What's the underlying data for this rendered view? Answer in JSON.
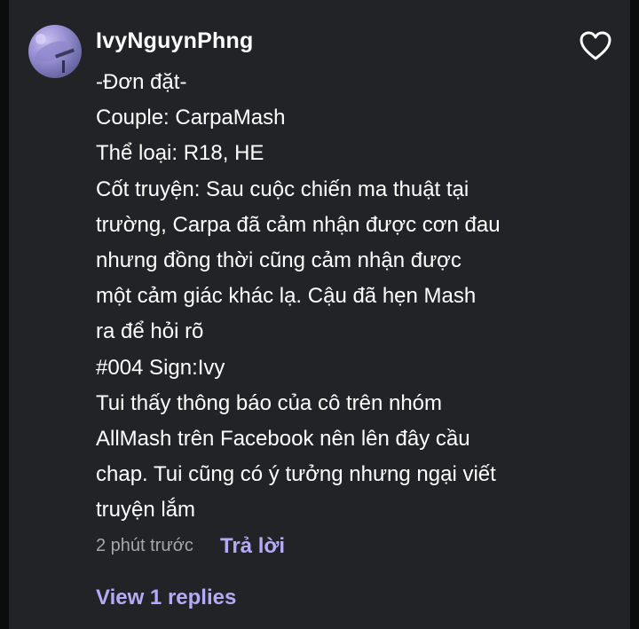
{
  "comment": {
    "username": "IvyNguynPhng",
    "lines": [
      "-Đơn đặt-",
      "Couple: CarpaMash",
      "Thể loại: R18, HE",
      "Cốt truyện: Sau cuộc chiến ma thuật tại",
      "trường, Carpa đã cảm nhận được cơn đau",
      "nhưng đồng thời cũng cảm nhận được",
      "một cảm giác khác lạ. Cậu đã hẹn Mash",
      "ra để hỏi rõ",
      "#004 Sign:Ivy",
      "Tui thấy thông báo của cô trên nhóm",
      "AllMash trên Facebook nên lên đây cầu",
      "chap. Tui cũng có ý tưởng nhưng ngại viết",
      "truyện lắm"
    ],
    "timestamp": "2 phút trước",
    "reply_label": "Trả lời",
    "view_replies_label": "View 1 replies",
    "icons": {
      "avatar": "avatar",
      "like": "heart-outline-icon"
    }
  },
  "colors": {
    "background": "#111315",
    "card": "#212326",
    "accent": "#b4aaf7",
    "muted_text": "#a7a8ab",
    "text": "#ffffff"
  }
}
